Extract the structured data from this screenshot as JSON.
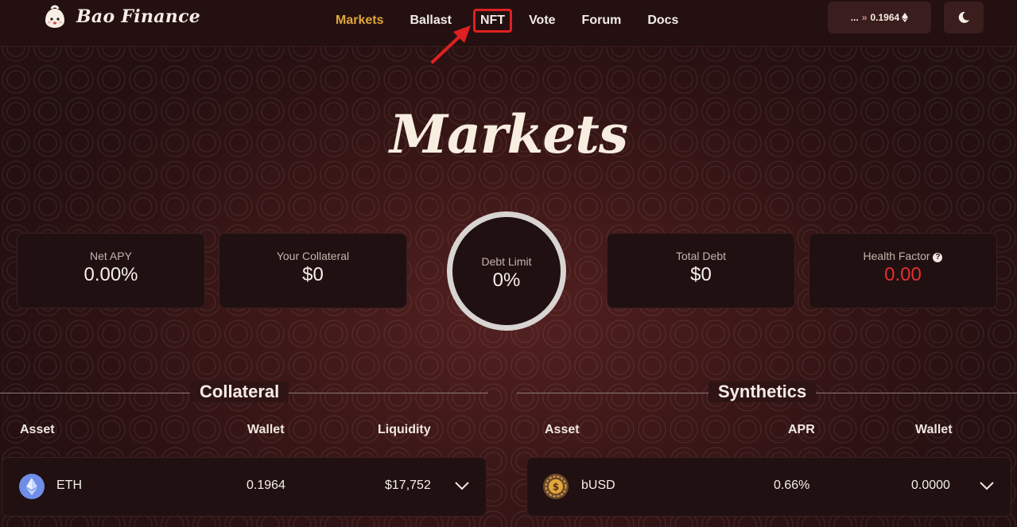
{
  "brand": {
    "name": "Bao Finance",
    "logo_icon": "bao-logo-icon"
  },
  "nav": {
    "items": [
      {
        "label": "Markets",
        "active": true
      },
      {
        "label": "Ballast"
      },
      {
        "label": "NFT",
        "highlighted": true
      },
      {
        "label": "Vote"
      },
      {
        "label": "Forum"
      },
      {
        "label": "Docs"
      }
    ]
  },
  "wallet": {
    "address": "...",
    "separator": "»",
    "balance": "0.1964",
    "icon": "ethereum-icon"
  },
  "theme_toggle": {
    "icon": "moon-icon"
  },
  "page": {
    "title": "Markets"
  },
  "stats": {
    "net_apy": {
      "label": "Net APY",
      "value": "0.00%"
    },
    "collateral": {
      "label": "Your Collateral",
      "value": "$0"
    },
    "debt_limit": {
      "label": "Debt Limit",
      "value": "0%"
    },
    "total_debt": {
      "label": "Total Debt",
      "value": "$0"
    },
    "health_factor": {
      "label": "Health Factor",
      "value": "0.00",
      "help_icon": "question-circle-icon"
    }
  },
  "collateral": {
    "title": "Collateral",
    "columns": [
      "Asset",
      "Wallet",
      "Liquidity"
    ],
    "rows": [
      {
        "asset": "ETH",
        "wallet": "0.1964",
        "liquidity": "$17,752",
        "icon": "ethereum-icon"
      }
    ]
  },
  "synthetics": {
    "title": "Synthetics",
    "columns": [
      "Asset",
      "APR",
      "Wallet"
    ],
    "rows": [
      {
        "asset": "bUSD",
        "apr": "0.66%",
        "wallet": "0.0000",
        "icon": "busd-icon"
      }
    ]
  },
  "colors": {
    "accent": "#e0a63a",
    "danger": "#e03030",
    "annotation": "#e02020",
    "background": "#2a1112"
  }
}
